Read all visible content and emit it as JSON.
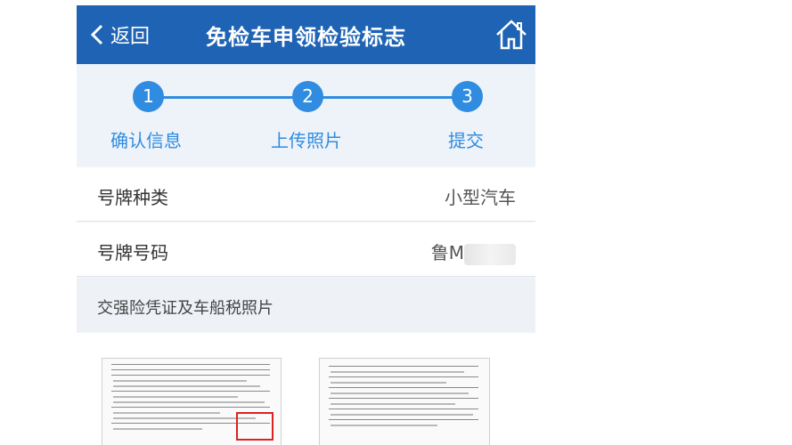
{
  "navbar": {
    "back_label": "返回",
    "title": "免检车申领检验标志"
  },
  "steps": [
    {
      "number": "1",
      "label": "确认信息"
    },
    {
      "number": "2",
      "label": "上传照片"
    },
    {
      "number": "3",
      "label": "提交"
    }
  ],
  "vehicle": {
    "plate_type_label": "号牌种类",
    "plate_type_value": "小型汽车",
    "plate_number_label": "号牌号码",
    "plate_number_value": "鲁M"
  },
  "photos": {
    "section_title": "交强险凭证及车船税照片"
  },
  "colors": {
    "navbar": "#1f63b4",
    "accent": "#2f8ce0"
  }
}
